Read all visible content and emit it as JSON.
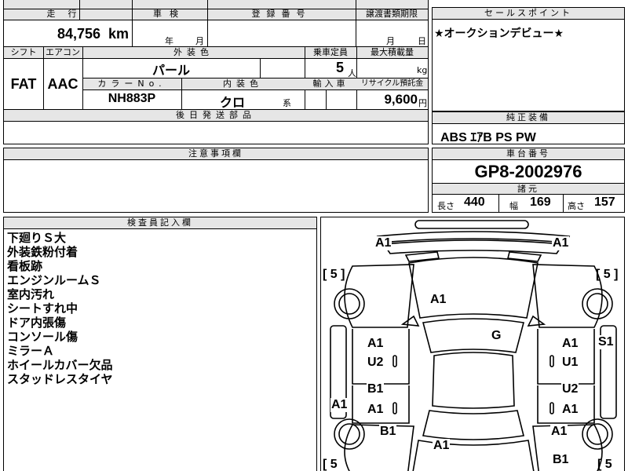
{
  "header": {
    "mileage_label": "走行",
    "mileage_value": "84,756",
    "mileage_unit": "km",
    "inspection_label": "車検",
    "inspection_year_unit": "年",
    "inspection_month_unit": "月",
    "registration_label": "登録番号",
    "transfer_label": "譲渡書類期限",
    "transfer_month_unit": "月",
    "transfer_day_unit": "日"
  },
  "specs": {
    "shift_label": "シフト",
    "shift_value": "FAT",
    "aircon_label": "エアコン",
    "aircon_value": "AAC",
    "exterior_color_label": "外装色",
    "exterior_color_value": "パール",
    "capacity_label": "乗車定員",
    "capacity_value": "5",
    "capacity_unit": "人",
    "max_load_label": "最大積載量",
    "max_load_unit": "kg",
    "color_no_label": "カラーNo.",
    "color_no_value": "NH883P",
    "interior_color_label": "内装色",
    "interior_color_value": "クロ",
    "interior_color_suffix": "系",
    "import_label": "輸入車",
    "recycle_label": "リサイクル預託金",
    "recycle_value": "9,600",
    "recycle_unit": "円",
    "followup_label": "後日発送部品"
  },
  "sales_point": {
    "label": "セールスポイント",
    "text": "★オークションデビュー★"
  },
  "genuine_equipment": {
    "label": "純正装備",
    "value": "ABS ｴｱB PS PW"
  },
  "caution": {
    "label": "注意事項欄"
  },
  "chassis": {
    "label": "車台番号",
    "value": "GP8-2002976",
    "dims_label": "諸元",
    "length_label": "長さ",
    "length_value": "440",
    "width_label": "幅",
    "width_value": "169",
    "height_label": "高さ",
    "height_value": "157"
  },
  "inspector": {
    "label": "検査員記入欄",
    "notes": [
      "下廻りＳ大",
      "外装鉄粉付着",
      "看板跡",
      "エンジンルームＳ",
      "室内汚れ",
      "シートすれ中",
      "ドア内張傷",
      "コンソール傷",
      "ミラーＡ",
      "ホイールカバー欠品",
      "スタッドレスタイヤ"
    ]
  },
  "diagram": {
    "tire_fl": "[ 5 ]",
    "tire_fr": "[ 5 ]",
    "tire_rl": "[ 5",
    "tire_rr": "[ 5",
    "marks": {
      "front_left_corner": "A1",
      "front_right_corner": "A1",
      "hood": "A1",
      "windshield": "G",
      "front_left_door_1": "A1",
      "front_left_door_2": "U2",
      "front_right_door_1": "A1",
      "front_right_door_2": "U1",
      "right_step": "S1",
      "rear_left_door_1": "B1",
      "rear_left_door_2": "A1",
      "rear_right_door_1": "U2",
      "rear_right_door_2": "A1",
      "left_step": "A1",
      "rear_left_fender": "B1",
      "rear_right_fender": "A1",
      "rear_gate": "A1",
      "rear_right_corner": "B1"
    }
  }
}
